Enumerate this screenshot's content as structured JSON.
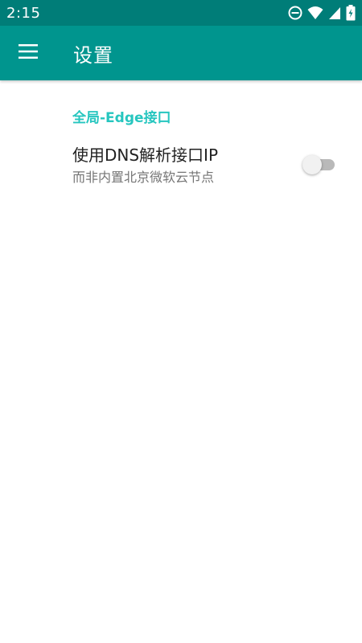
{
  "status_bar": {
    "time": "2:15",
    "icons": [
      "do-not-disturb-icon",
      "wifi-icon",
      "signal-icon",
      "battery-charging-icon"
    ]
  },
  "app_bar": {
    "title": "设置",
    "nav_icon": "menu-icon"
  },
  "settings": {
    "category": "全局-Edge接口",
    "items": [
      {
        "title": "使用DNS解析接口IP",
        "summary": "而非内置北京微软云节点",
        "enabled": false
      }
    ]
  },
  "colors": {
    "status_bar": "#007d78",
    "app_bar": "#00958e",
    "accent": "#26c6bf"
  }
}
